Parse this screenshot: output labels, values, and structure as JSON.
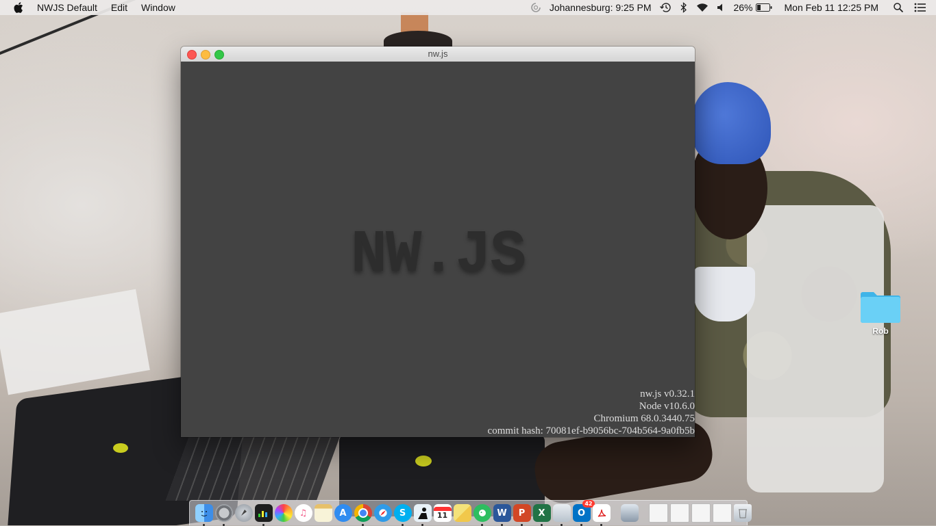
{
  "menubar": {
    "app_name": "NWJS Default",
    "items": [
      "Edit",
      "Window"
    ],
    "clock_city": "Johannesburg: 9:25 PM",
    "battery_percent": "26%",
    "datetime": "Mon Feb 11  12:25 PM"
  },
  "window": {
    "title": "nw.js",
    "logo_text": "NW.JS",
    "versions": [
      "nw.js v0.32.1",
      "Node v10.6.0",
      "Chromium 68.0.3440.75",
      "commit hash: 70081ef-b9056bc-704b564-9a0fb5b"
    ]
  },
  "desktop": {
    "folder_label": "Rob"
  },
  "dock": {
    "calendar_day": "11",
    "outlook_badge": "42",
    "apps": [
      {
        "name": "finder",
        "color": "#3d8ee8"
      },
      {
        "name": "system-preferences",
        "color": "#8a8d92"
      },
      {
        "name": "launchpad",
        "color": "#9aa0a8"
      },
      {
        "name": "activity-monitor",
        "color": "#222222"
      },
      {
        "name": "photos",
        "color": "#f2f2f2"
      },
      {
        "name": "itunes",
        "color": "#f25f8c"
      },
      {
        "name": "notes",
        "color": "#d9b35a"
      },
      {
        "name": "app-store",
        "color": "#2f8cf0"
      },
      {
        "name": "chrome",
        "color": "#ffffff"
      },
      {
        "name": "safari",
        "color": "#2f9be8"
      },
      {
        "name": "skype",
        "color": "#00aff0"
      },
      {
        "name": "kindle",
        "color": "#1c2a3a"
      },
      {
        "name": "calendar",
        "color": "#ffffff"
      },
      {
        "name": "stickies",
        "color": "#f4e27a"
      },
      {
        "name": "evernote",
        "color": "#2dbe60"
      },
      {
        "name": "word",
        "color": "#2b579a"
      },
      {
        "name": "powerpoint",
        "color": "#d24726"
      },
      {
        "name": "excel",
        "color": "#217346"
      },
      {
        "name": "preview",
        "color": "#cfd8e0"
      },
      {
        "name": "outlook",
        "color": "#0072c6"
      },
      {
        "name": "acrobat",
        "color": "#ffffff"
      }
    ]
  }
}
